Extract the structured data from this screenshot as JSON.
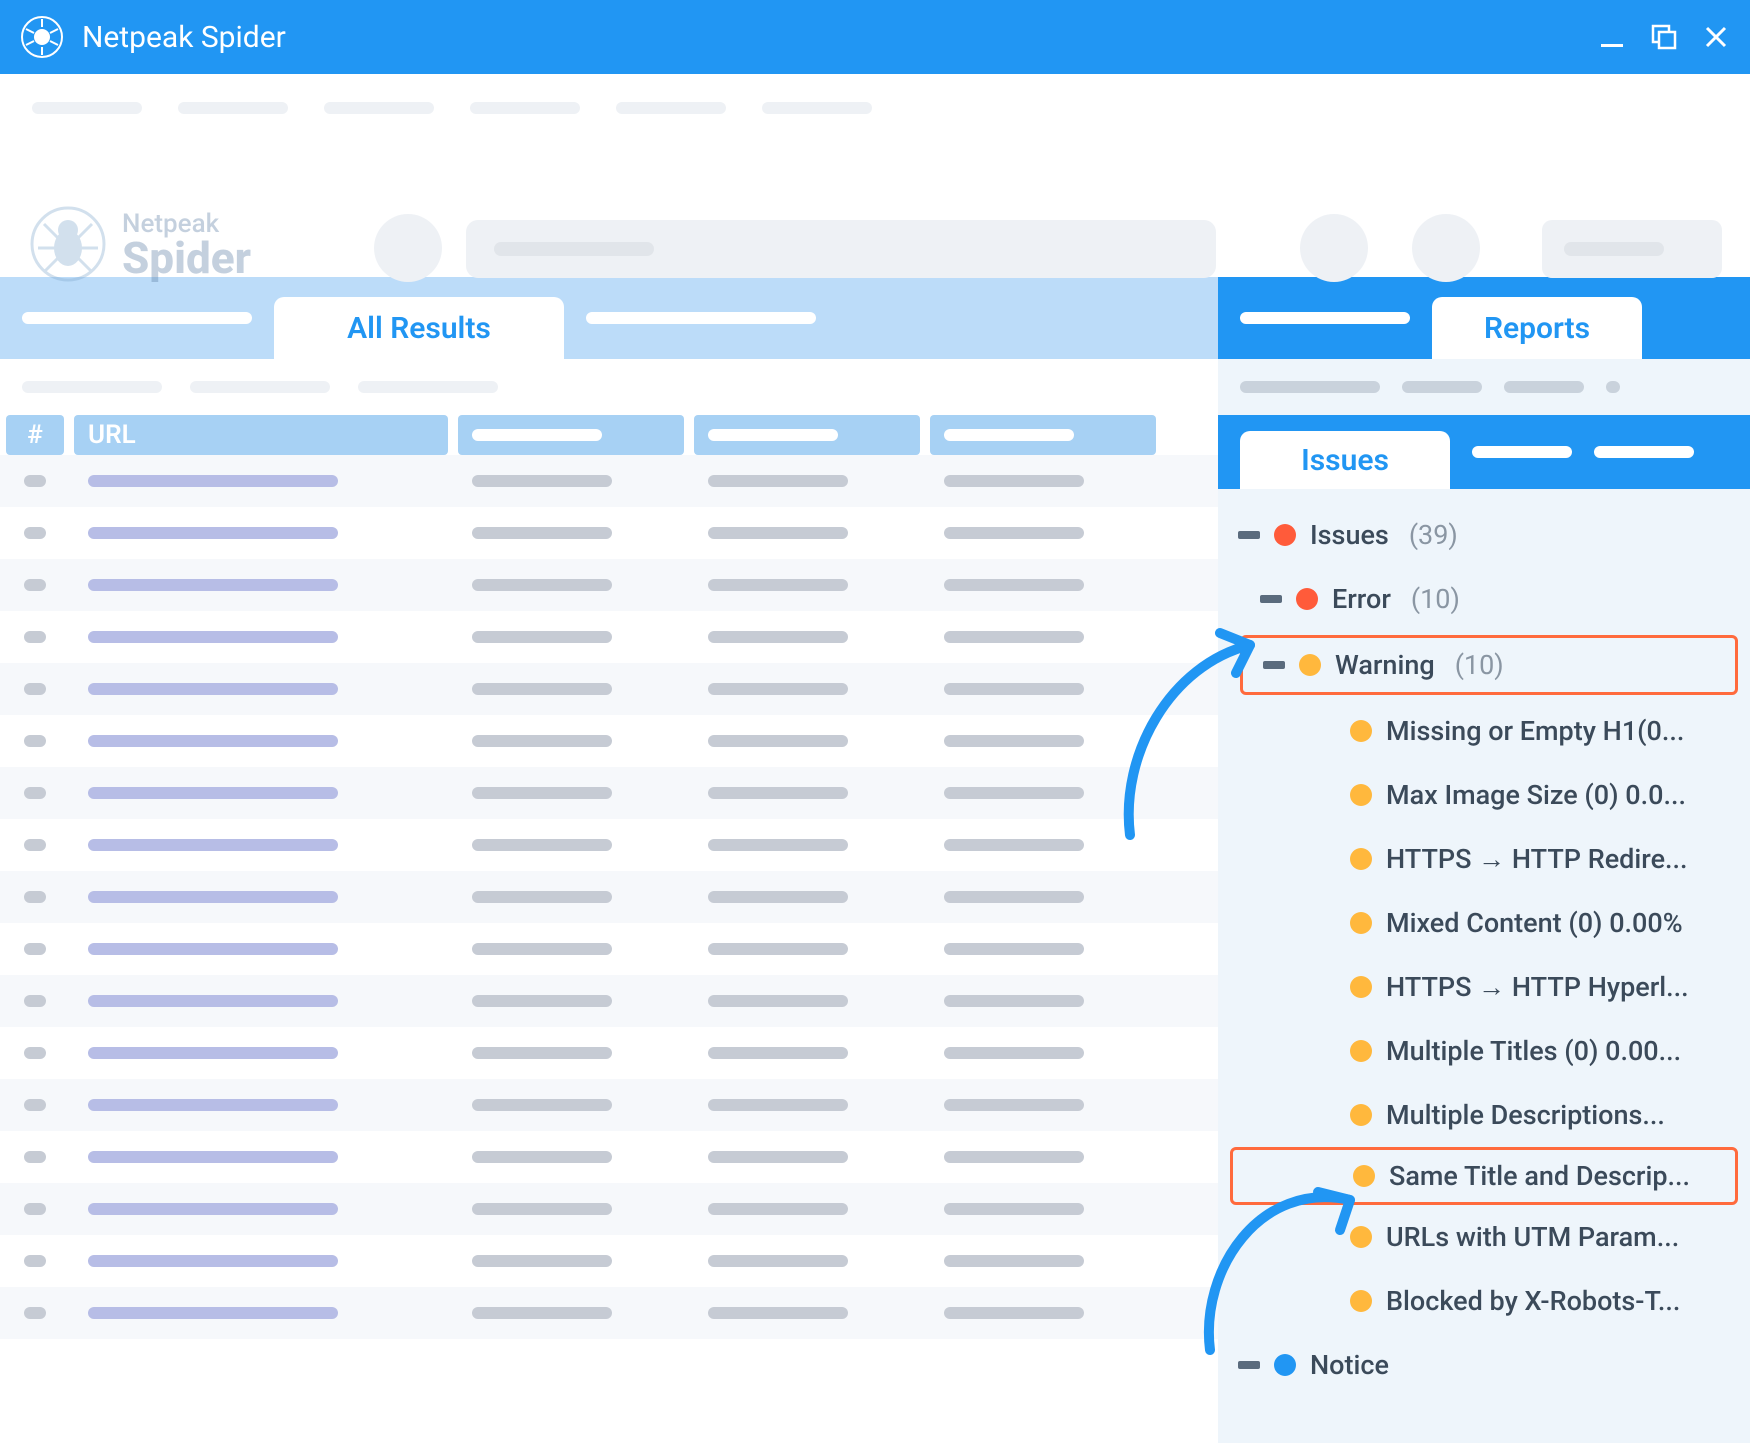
{
  "window": {
    "title": "Netpeak Spider",
    "brand_top": "Netpeak",
    "brand_bottom": "Spider"
  },
  "main_tabs": {
    "active": "All Results"
  },
  "table": {
    "headers": {
      "num": "#",
      "url": "URL"
    },
    "row_count": 17
  },
  "right_panel": {
    "reports_tab": "Reports",
    "issues_tab": "Issues"
  },
  "issues_tree": {
    "root": {
      "label": "Issues",
      "count": "(39)"
    },
    "error": {
      "label": "Error",
      "count": "(10)"
    },
    "warning": {
      "label": "Warning",
      "count": "(10)"
    },
    "warning_items": [
      "Missing or Empty H1(0...",
      "Max Image Size (0) 0.0...",
      "HTTPS → HTTP Redire...",
      "Mixed Content (0) 0.00%",
      "HTTPS → HTTP Hyperl...",
      "Multiple Titles (0) 0.00...",
      "Multiple Descriptions...",
      "Same Title and Descrip...",
      "URLs with UTM Param...",
      "Blocked by X-Robots-T..."
    ],
    "highlighted_item_index": 7,
    "notice": {
      "label": "Notice"
    }
  },
  "colors": {
    "primary": "#2196F3",
    "error": "#ff5b3a",
    "warning": "#ffb83d",
    "highlight_border": "#ff6a3d"
  }
}
